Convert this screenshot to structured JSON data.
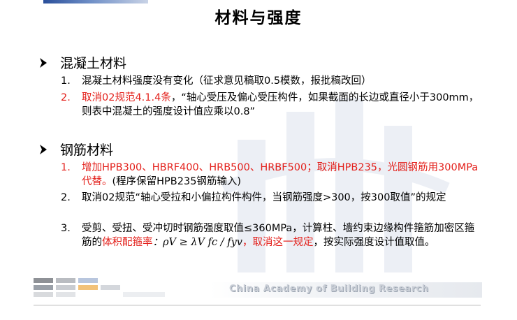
{
  "title": "材料与强度",
  "sections": [
    {
      "heading": "混凝土材料",
      "items": [
        {
          "num": "1.",
          "text": "混凝土材料强度没有变化（征求意见稿取0.5模数，报批稿改回）"
        },
        {
          "num": "2.",
          "red": "取消02规范4.1.4条",
          "text": "，“轴心受压及偏心受压构件，如果截面的长边或直径小于300mm，则表中混凝土的强度设计值应乘以0.8”"
        }
      ]
    },
    {
      "heading": "钢筋材料",
      "items": [
        {
          "num": "1.",
          "red": "增加HPB300、HBRF400、HRB500、HRBF500；取消HPB235，光圆钢筋用300MPa代替。",
          "text": "(程序保留HPB235钢筋输入)"
        },
        {
          "num": "2.",
          "text": "取消02规范“轴心受拉和小偏拉构件构件，当钢筋强度>300，按300取值”的规定"
        },
        {
          "num": "3.",
          "text_a": "受剪、受扭、受冲切时钢筋强度取值≤360MPa，计算柱、墙约束边缘构件箍筋加密区箍筋的",
          "red_a": "体积配箍率",
          "formula": "：ρV ≥ λV fc / fyv",
          "red_b": "，取消这一规定",
          "text_b": "，按实际强度设计值取值。"
        }
      ]
    }
  ],
  "footer": {
    "text": "China Academy of Building Research"
  }
}
